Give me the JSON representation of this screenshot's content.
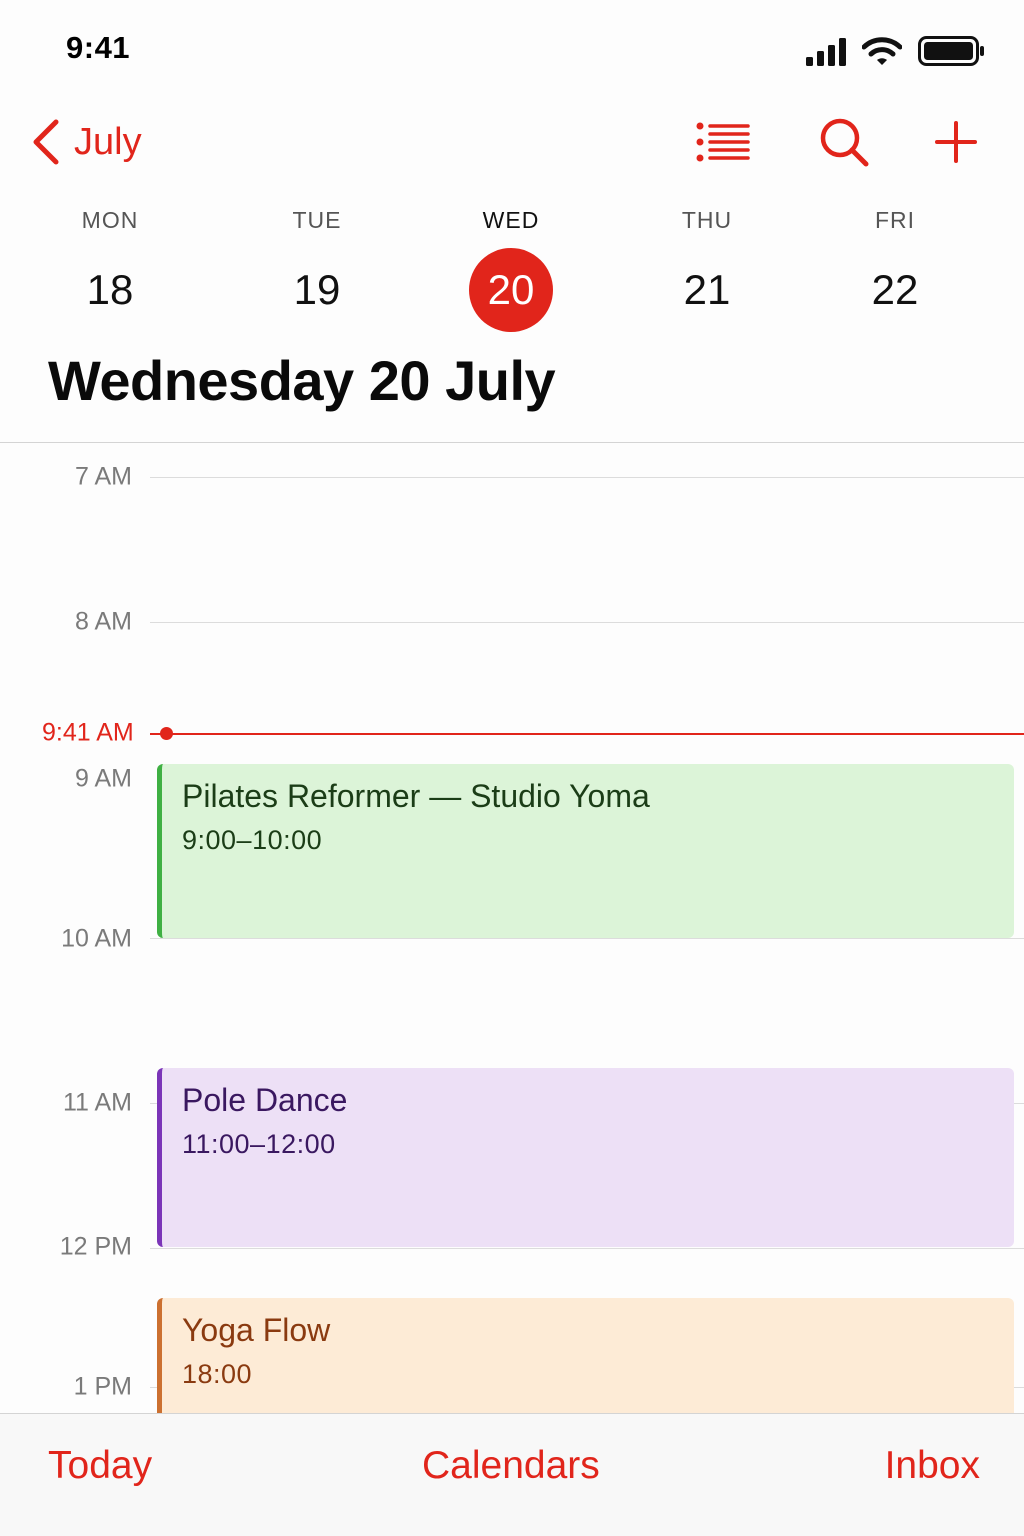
{
  "status_bar": {
    "time": "9:41",
    "icons": [
      "signal-icon",
      "wifi-icon",
      "battery-icon"
    ]
  },
  "nav": {
    "back_label": "July",
    "back_icon": "chevron-left-icon",
    "actions": [
      "list-icon",
      "search-icon",
      "add-icon"
    ]
  },
  "week": {
    "days": [
      {
        "name": "MON",
        "num": "18",
        "selected": false
      },
      {
        "name": "TUE",
        "num": "19",
        "selected": false
      },
      {
        "name": "WED",
        "num": "20",
        "selected": true
      },
      {
        "name": "THU",
        "num": "21",
        "selected": false
      },
      {
        "name": "FRI",
        "num": "22",
        "selected": false
      }
    ]
  },
  "date_title": "Wednesday 20 July",
  "timeline": {
    "hours": [
      "7 AM",
      "8 AM",
      "9 AM",
      "10 AM",
      "11 AM",
      "12 PM",
      "1 PM"
    ],
    "now_label": "9:41 AM",
    "events": [
      {
        "title": "Pilates Reformer — Studio Yoma",
        "time": "9:00–10:00",
        "color": "#3fb043"
      },
      {
        "title": "Pole Dance",
        "time": "11:00–12:00",
        "color": "#7b35b8"
      },
      {
        "title": "Yoga Flow",
        "time": "18:00",
        "color": "#cc7030"
      }
    ]
  },
  "tabs": {
    "today": "Today",
    "calendars": "Calendars",
    "inbox": "Inbox"
  },
  "colors": {
    "accent": "#e1251b"
  }
}
